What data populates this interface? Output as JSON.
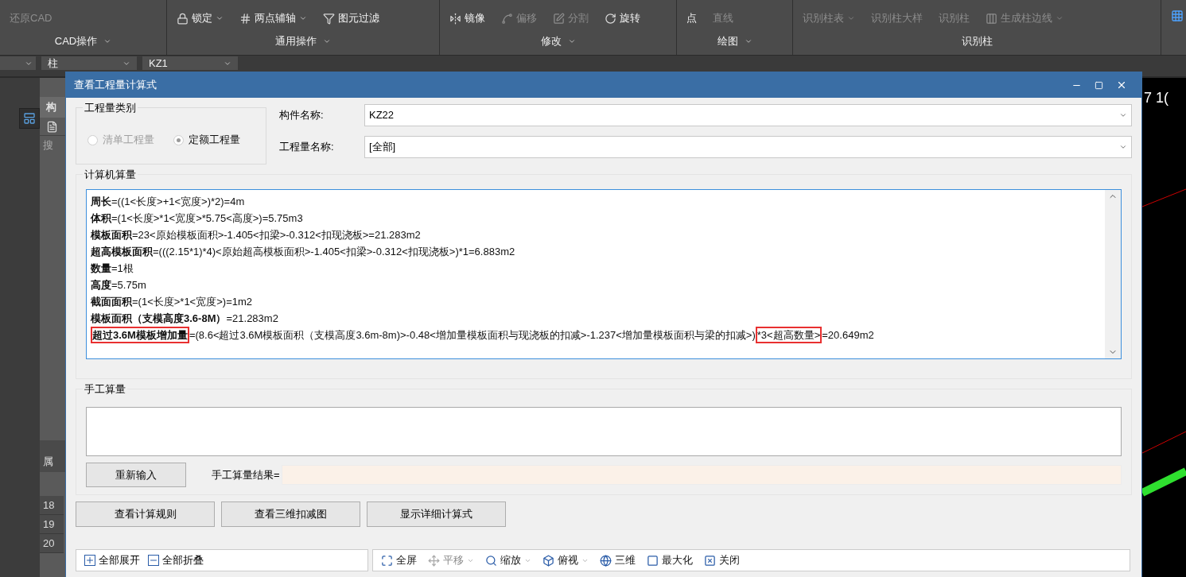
{
  "ribbon": {
    "groups": [
      {
        "label": "CAD操作",
        "menu": true,
        "items": [
          {
            "label": "还原CAD",
            "disabled": true,
            "caret": false
          }
        ]
      },
      {
        "label": "通用操作",
        "menu": true,
        "items": [
          {
            "label": "锁定",
            "disabled": false,
            "caret": true
          },
          {
            "label": "两点辅轴",
            "disabled": false,
            "caret": true
          },
          {
            "label": "图元过滤",
            "disabled": false,
            "caret": false
          }
        ]
      },
      {
        "label": "修改",
        "menu": true,
        "items": [
          {
            "label": "镜像",
            "disabled": false,
            "caret": false
          },
          {
            "label": "偏移",
            "disabled": true,
            "caret": false
          },
          {
            "label": "分割",
            "disabled": true,
            "caret": false
          },
          {
            "label": "旋转",
            "disabled": false,
            "caret": false
          }
        ]
      },
      {
        "label": "绘图",
        "menu": true,
        "items": [
          {
            "label": "点",
            "disabled": false,
            "caret": false
          },
          {
            "label": "直线",
            "disabled": true,
            "caret": false
          }
        ]
      },
      {
        "label": "识别柱",
        "menu": false,
        "items": [
          {
            "label": "识别柱表",
            "disabled": true,
            "caret": true
          },
          {
            "label": "识别柱大样",
            "disabled": true,
            "caret": false
          },
          {
            "label": "识别柱",
            "disabled": true,
            "caret": false
          },
          {
            "label": "生成柱边线",
            "disabled": true,
            "caret": true
          }
        ]
      }
    ]
  },
  "selectors": [
    {
      "value": "柱"
    },
    {
      "value": "KZ1"
    }
  ],
  "left_panel": {
    "tab": "构",
    "search": "搜",
    "section": "属",
    "rows": [
      "18",
      "19",
      "20"
    ]
  },
  "canvas": {
    "text": "7 1("
  },
  "dialog": {
    "title": "查看工程量计算式",
    "category": {
      "legend": "工程量类别",
      "options": [
        {
          "label": "清单工程量",
          "selected": false,
          "disabled": true
        },
        {
          "label": "定额工程量",
          "selected": true,
          "disabled": false
        }
      ]
    },
    "fields": [
      {
        "label": "构件名称:",
        "value": "KZ22"
      },
      {
        "label": "工程量名称:",
        "value": "[全部]"
      }
    ],
    "computer": {
      "legend": "计算机算量",
      "lines": [
        [
          {
            "text": "周长",
            "bold": true,
            "highlighted": false
          },
          {
            "text": "=((1<长度>+1<宽度>)*2)=4m",
            "bold": false,
            "highlighted": false
          }
        ],
        [
          {
            "text": "体积",
            "bold": true,
            "highlighted": false
          },
          {
            "text": "=(1<长度>*1<宽度>*5.75<高度>)=5.75m3",
            "bold": false,
            "highlighted": false
          }
        ],
        [
          {
            "text": "模板面积",
            "bold": true,
            "highlighted": false
          },
          {
            "text": "=23<原始模板面积>-1.405<扣梁>-0.312<扣现浇板>=21.283m2",
            "bold": false,
            "highlighted": false
          }
        ],
        [
          {
            "text": "超高模板面积",
            "bold": true,
            "highlighted": false
          },
          {
            "text": "=(((2.15*1)*4)<原始超高模板面积>-1.405<扣梁>-0.312<扣现浇板>)*1=6.883m2",
            "bold": false,
            "highlighted": false
          }
        ],
        [
          {
            "text": "数量",
            "bold": true,
            "highlighted": false
          },
          {
            "text": "=1根",
            "bold": false,
            "highlighted": false
          }
        ],
        [
          {
            "text": "高度",
            "bold": true,
            "highlighted": false
          },
          {
            "text": "=5.75m",
            "bold": false,
            "highlighted": false
          }
        ],
        [
          {
            "text": "截面面积",
            "bold": true,
            "highlighted": false
          },
          {
            "text": "=(1<长度>*1<宽度>)=1m2",
            "bold": false,
            "highlighted": false
          }
        ],
        [
          {
            "text": "模板面积（支模高度3.6-8M）",
            "bold": true,
            "highlighted": false
          },
          {
            "text": "=21.283m2",
            "bold": false,
            "highlighted": false
          }
        ],
        [
          {
            "text": "超过3.6M模板增加量",
            "bold": true,
            "highlighted": true
          },
          {
            "text": "=(8.6<超过3.6M模板面积（支模高度3.6m-8m)>-0.48<增加量模板面积与现浇板的扣减>-1.237<增加量模板面积与梁的扣减>)",
            "bold": false,
            "highlighted": false
          },
          {
            "text": "*3<超高数量>",
            "bold": false,
            "highlighted": true
          },
          {
            "text": "=20.649m2",
            "bold": false,
            "highlighted": false
          }
        ]
      ]
    },
    "manual": {
      "legend": "手工算量",
      "reset_button": "重新输入",
      "result_label": "手工算量结果="
    },
    "buttons": [
      "查看计算规则",
      "查看三维扣减图",
      "显示详细计算式"
    ],
    "tree_tools": [
      "全部展开",
      "全部折叠"
    ],
    "view_tools": [
      {
        "label": "全屏",
        "disabled": false,
        "caret": false
      },
      {
        "label": "平移",
        "disabled": true,
        "caret": true
      },
      {
        "label": "缩放",
        "disabled": false,
        "caret": true
      },
      {
        "label": "俯视",
        "disabled": false,
        "caret": true
      },
      {
        "label": "三维",
        "disabled": false,
        "caret": false
      },
      {
        "label": "最大化",
        "disabled": false,
        "caret": false
      },
      {
        "label": "关闭",
        "disabled": false,
        "caret": false
      }
    ]
  }
}
